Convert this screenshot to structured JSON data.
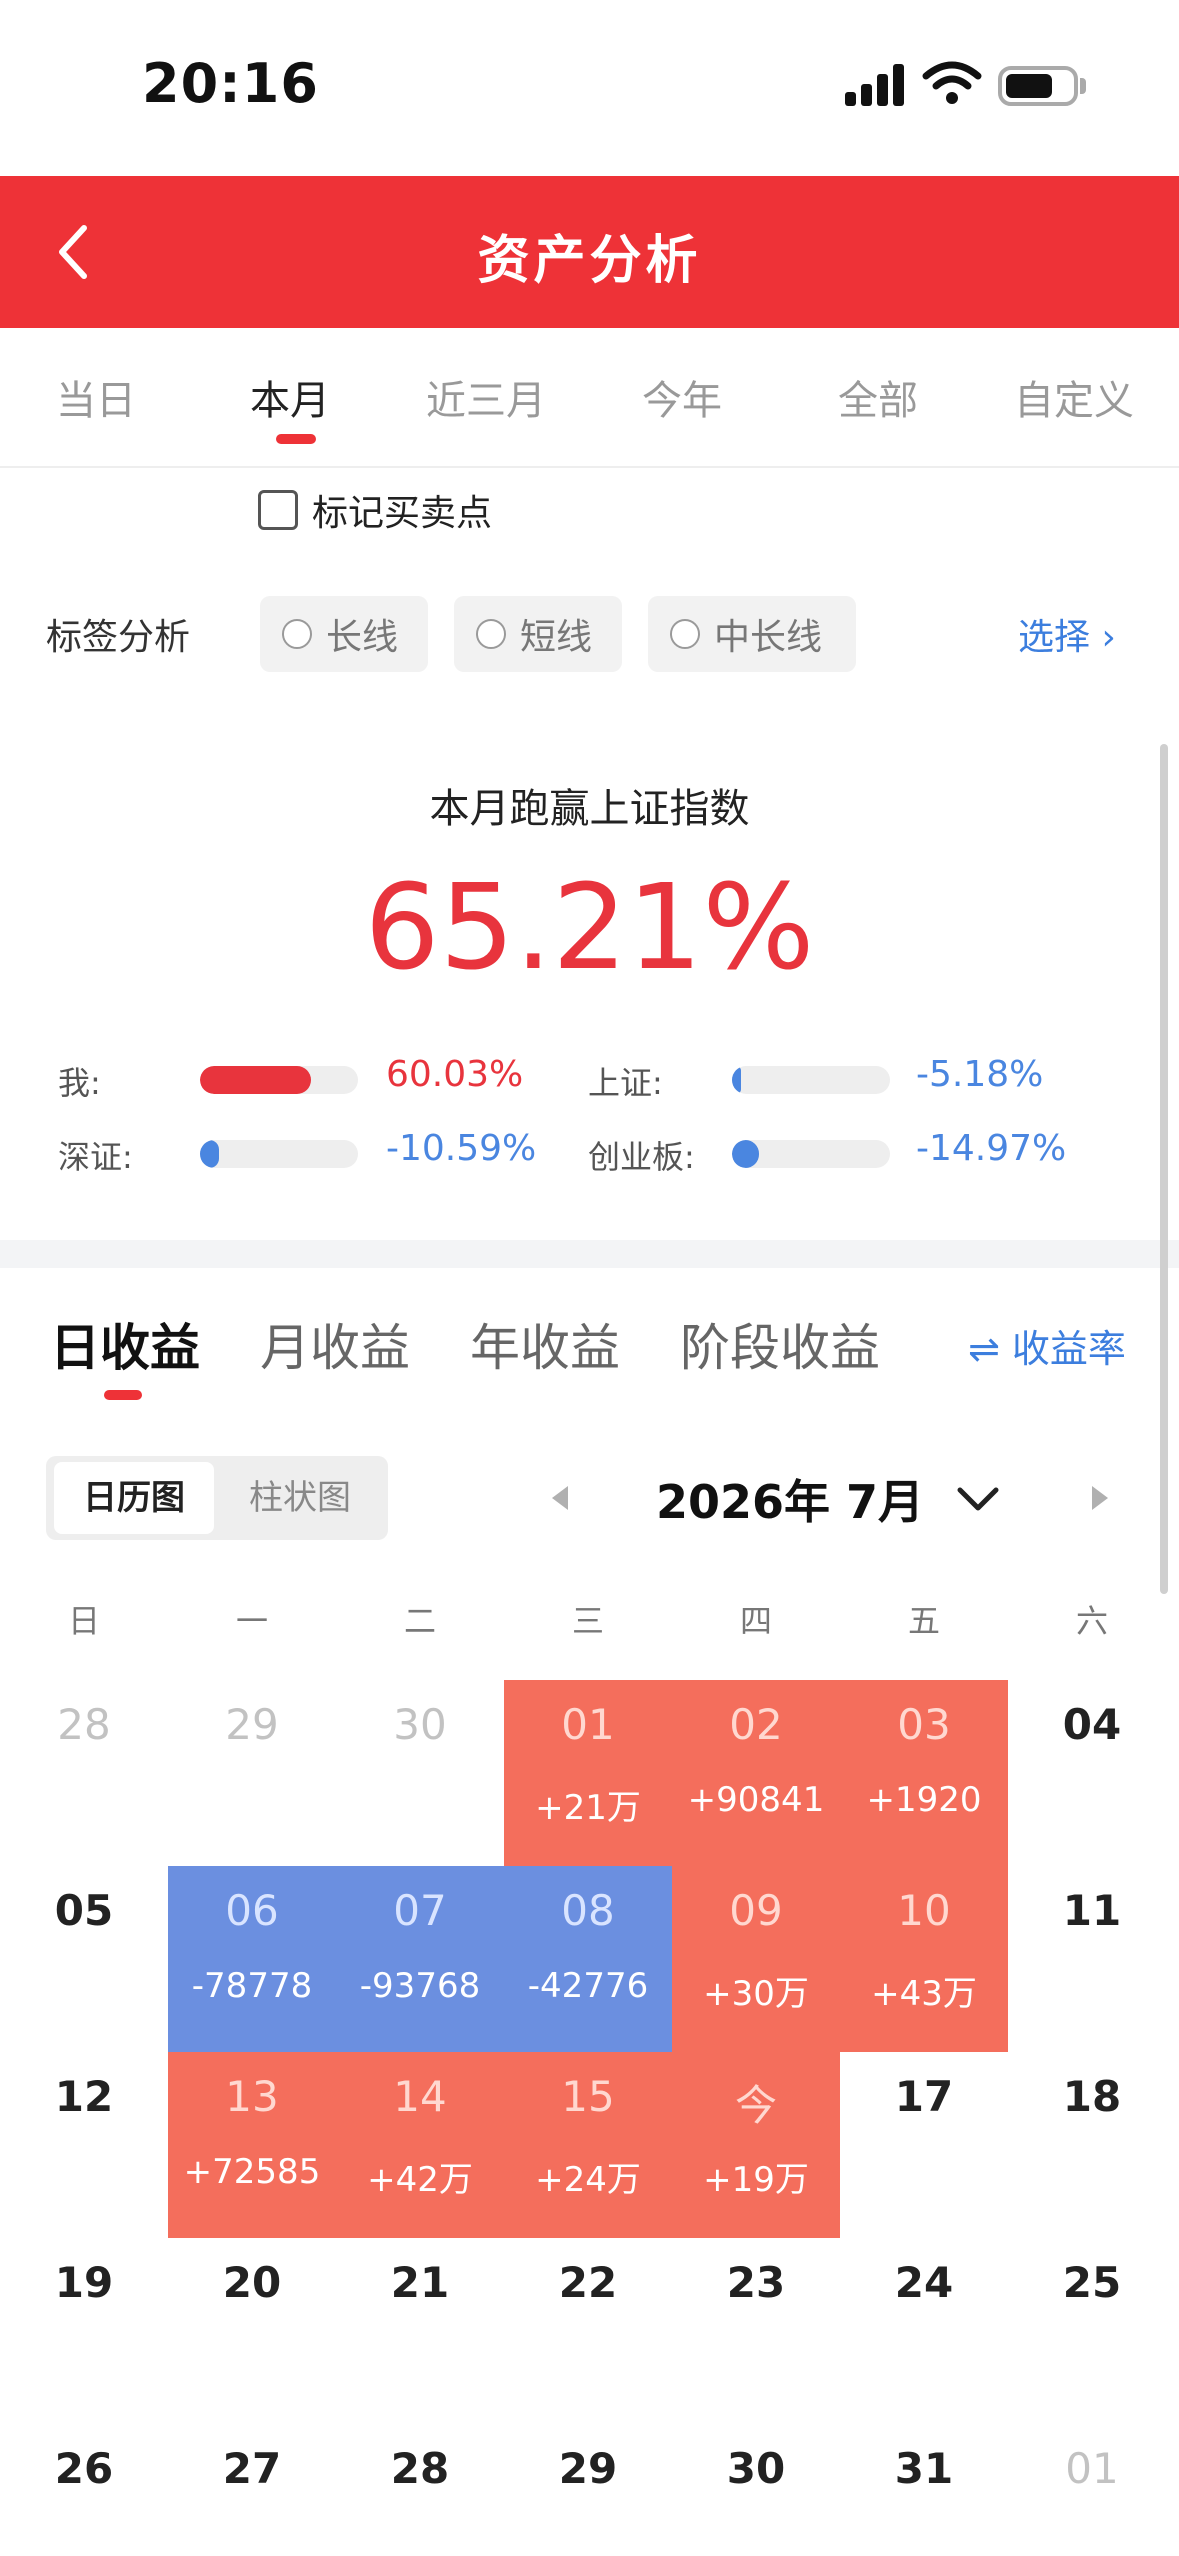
{
  "status_bar": {
    "time": "20:16"
  },
  "header": {
    "title": "资产分析"
  },
  "period_tabs": [
    {
      "label": "当日",
      "active": false
    },
    {
      "label": "本月",
      "active": true
    },
    {
      "label": "近三月",
      "active": false
    },
    {
      "label": "今年",
      "active": false
    },
    {
      "label": "全部",
      "active": false
    },
    {
      "label": "自定义",
      "active": false
    }
  ],
  "mark_points": {
    "label": "标记买卖点",
    "checked": false
  },
  "tag_analysis": {
    "title": "标签分析",
    "chips": [
      "长线",
      "短线",
      "中长线"
    ],
    "select_label": "选择 ›"
  },
  "summary": {
    "title": "本月跑赢上证指数",
    "value": "65.21%",
    "comparisons": [
      {
        "label": "我:",
        "value": "60.03%",
        "fill_fraction": 0.7,
        "color": "#e8343d"
      },
      {
        "label": "上证:",
        "value": "-5.18%",
        "fill_fraction": 0.06,
        "color": "#4a86e0"
      },
      {
        "label": "深证:",
        "value": "-10.59%",
        "fill_fraction": 0.12,
        "color": "#4a86e0"
      },
      {
        "label": "创业板:",
        "value": "-14.97%",
        "fill_fraction": 0.17,
        "color": "#4a86e0"
      }
    ]
  },
  "profit_tabs": [
    {
      "label": "日收益",
      "active": true
    },
    {
      "label": "月收益",
      "active": false
    },
    {
      "label": "年收益",
      "active": false
    },
    {
      "label": "阶段收益",
      "active": false
    }
  ],
  "rate_toggle": "⇌ 收益率",
  "view_switch": [
    {
      "label": "日历图",
      "active": true
    },
    {
      "label": "柱状图",
      "active": false
    }
  ],
  "calendar": {
    "month_label": "2026年 7月",
    "weekdays": [
      "日",
      "一",
      "二",
      "三",
      "四",
      "五",
      "六"
    ],
    "weeks": [
      [
        {
          "day": "28",
          "type": "other"
        },
        {
          "day": "29",
          "type": "other"
        },
        {
          "day": "30",
          "type": "other"
        },
        {
          "day": "01",
          "value": "+21万",
          "type": "gain"
        },
        {
          "day": "02",
          "value": "+90841",
          "type": "gain"
        },
        {
          "day": "03",
          "value": "+1920",
          "type": "gain"
        },
        {
          "day": "04",
          "type": "plain"
        }
      ],
      [
        {
          "day": "05",
          "type": "plain"
        },
        {
          "day": "06",
          "value": "-78778",
          "type": "loss"
        },
        {
          "day": "07",
          "value": "-93768",
          "type": "loss"
        },
        {
          "day": "08",
          "value": "-42776",
          "type": "loss"
        },
        {
          "day": "09",
          "value": "+30万",
          "type": "gain"
        },
        {
          "day": "10",
          "value": "+43万",
          "type": "gain"
        },
        {
          "day": "11",
          "type": "plain"
        }
      ],
      [
        {
          "day": "12",
          "type": "plain"
        },
        {
          "day": "13",
          "value": "+72585",
          "type": "gain"
        },
        {
          "day": "14",
          "value": "+42万",
          "type": "gain"
        },
        {
          "day": "15",
          "value": "+24万",
          "type": "gain"
        },
        {
          "day": "今",
          "value": "+19万",
          "type": "gain"
        },
        {
          "day": "17",
          "type": "plain"
        },
        {
          "day": "18",
          "type": "plain"
        }
      ],
      [
        {
          "day": "19",
          "type": "plain"
        },
        {
          "day": "20",
          "type": "plain"
        },
        {
          "day": "21",
          "type": "plain"
        },
        {
          "day": "22",
          "type": "plain"
        },
        {
          "day": "23",
          "type": "plain"
        },
        {
          "day": "24",
          "type": "plain"
        },
        {
          "day": "25",
          "type": "plain"
        }
      ],
      [
        {
          "day": "26",
          "type": "plain"
        },
        {
          "day": "27",
          "type": "plain"
        },
        {
          "day": "28",
          "type": "plain"
        },
        {
          "day": "29",
          "type": "plain"
        },
        {
          "day": "30",
          "type": "plain"
        },
        {
          "day": "31",
          "type": "plain"
        },
        {
          "day": "01",
          "type": "other"
        }
      ]
    ]
  },
  "colors": {
    "brand_red": "#ee3237",
    "gain": "#f46e5c",
    "loss": "#6b8fe0",
    "link_blue": "#3c7ede"
  }
}
